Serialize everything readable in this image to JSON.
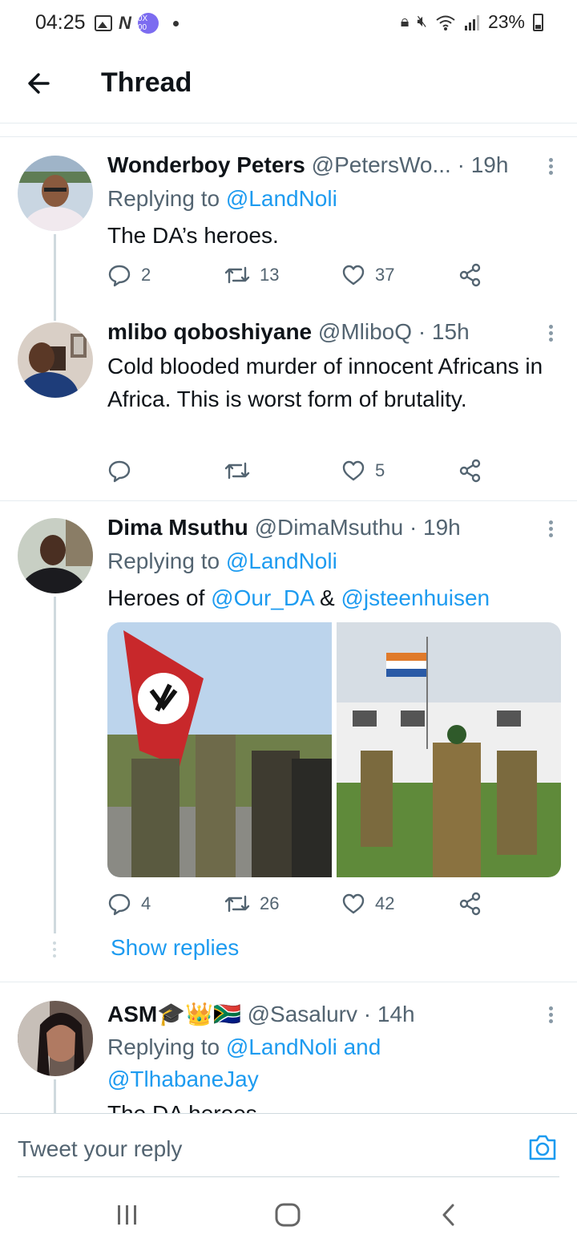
{
  "status_bar": {
    "time": "04:25",
    "notif_app_label": "0X 00",
    "battery": "23%"
  },
  "header": {
    "title": "Thread",
    "back_icon": "arrow-left-icon"
  },
  "tweets": [
    {
      "name": "Wonderboy Peters",
      "handle": "@PetersWo...",
      "time": "· 19h",
      "replying_prefix": "Replying to ",
      "replying_to": "@LandNoli",
      "text": "The DA’s heroes.",
      "replies": "2",
      "retweets": "13",
      "likes": "37"
    },
    {
      "name": "mlibo qoboshiyane",
      "handle": "@MliboQ",
      "time": "· 15h",
      "text": "Cold blooded murder of innocent Africans in Africa. This is worst form of brutality.",
      "replies": "",
      "retweets": "",
      "likes": "5"
    },
    {
      "name": "Dima Msuthu",
      "handle": "@DimaMsuthu",
      "time": "· 19h",
      "replying_prefix": "Replying to ",
      "replying_to": "@LandNoli",
      "text_prefix": "Heroes of ",
      "mention_1": "@Our_DA",
      "text_mid": " & ",
      "mention_2": "@jsteenhuisen",
      "replies": "4",
      "retweets": "26",
      "likes": "42",
      "show_replies": "Show replies"
    },
    {
      "name": "ASM",
      "name_emoji": "🎓👑🇿🇦",
      "handle": "@Sasalurv",
      "time": "· 14h",
      "replying_prefix": "Replying to ",
      "replying_to": "@LandNoli and",
      "replying_to_2": "@TlhabaneJay",
      "text_partial": "The DA heroes"
    }
  ],
  "reply_bar": {
    "placeholder": "Tweet your reply",
    "camera_icon": "camera-icon"
  },
  "colors": {
    "accent": "#1d9bf0",
    "text_primary": "#0f1419",
    "text_secondary": "#536471",
    "divider": "#e6ecf0"
  }
}
